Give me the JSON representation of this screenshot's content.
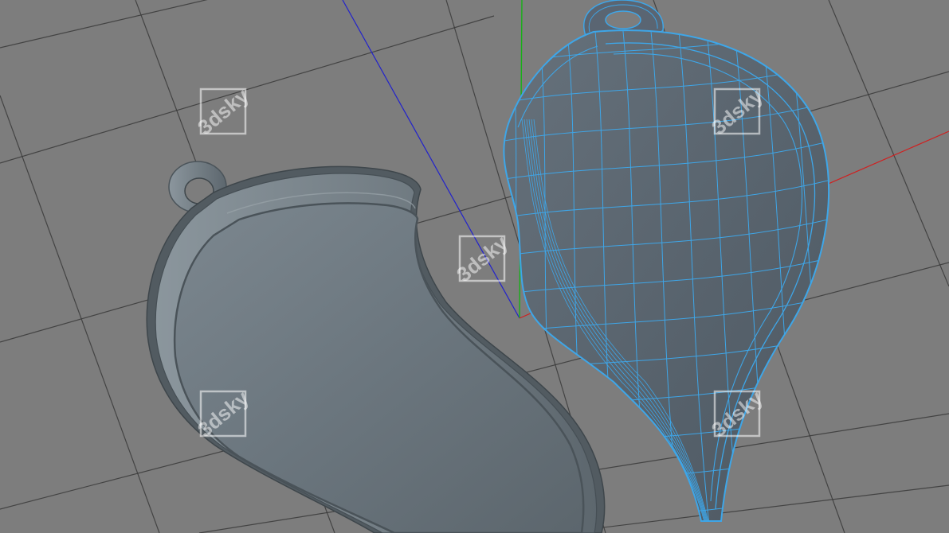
{
  "viewport": {
    "background": "#7d7d7d",
    "grid_color": "#3a3a3a",
    "axis_colors": {
      "x": "#d02020",
      "y": "#18b018",
      "z": "#2020c8"
    },
    "watermark_text": "3dsky",
    "watermark_color": "#ffffff"
  },
  "scene": {
    "solid_model": {
      "name": "heart-half-pendant-solid",
      "shading": "smooth",
      "color": "#6f7a82"
    },
    "wire_model": {
      "name": "heart-half-pendant-wireframe",
      "shading": "wireframe-on-shaded",
      "color": "#5a6572",
      "wire_color": "#3ea6e8"
    }
  }
}
